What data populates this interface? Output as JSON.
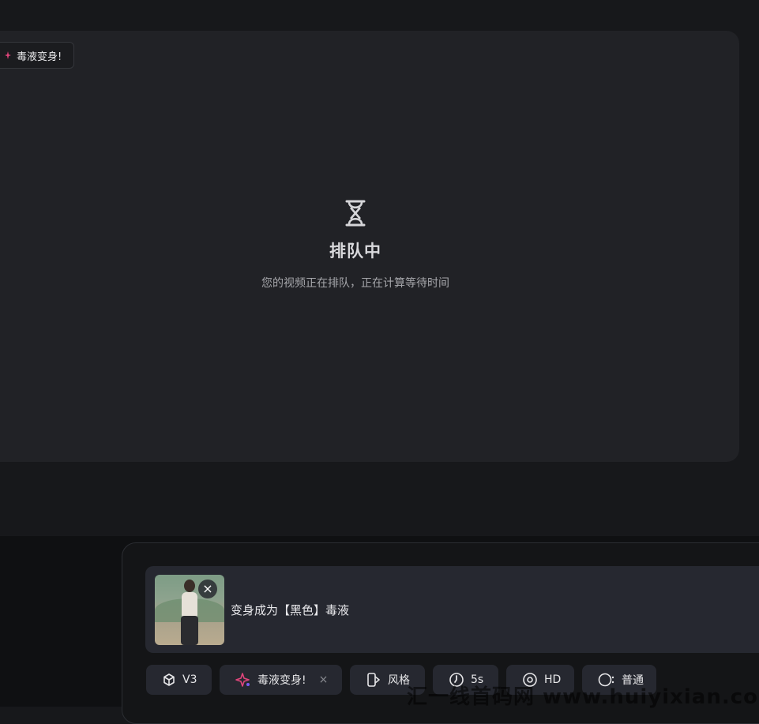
{
  "effect_tag": {
    "label": "毒液变身!"
  },
  "queue": {
    "title": "排队中",
    "description": "您的视频正在排队，正在计算等待时间"
  },
  "prompt": {
    "text": "变身成为【黑色】毒液",
    "remove_label": "×"
  },
  "options": [
    {
      "id": "model",
      "icon": "cube-icon",
      "label": "V3"
    },
    {
      "id": "effect",
      "icon": "sparkle-icon",
      "label": "毒液变身!",
      "remove_label": "×"
    },
    {
      "id": "style",
      "icon": "style-icon",
      "label": "风格"
    },
    {
      "id": "duration",
      "icon": "timer-icon",
      "label": "5s"
    },
    {
      "id": "quality",
      "icon": "quality-icon",
      "label": "HD"
    },
    {
      "id": "mode",
      "icon": "mode-icon",
      "label": "普通"
    }
  ],
  "watermark": "汇一线首码网 www.huiyixian.com",
  "colors": {
    "accent_pink": "#e0457b",
    "accent_purple": "#7b5cf0"
  }
}
